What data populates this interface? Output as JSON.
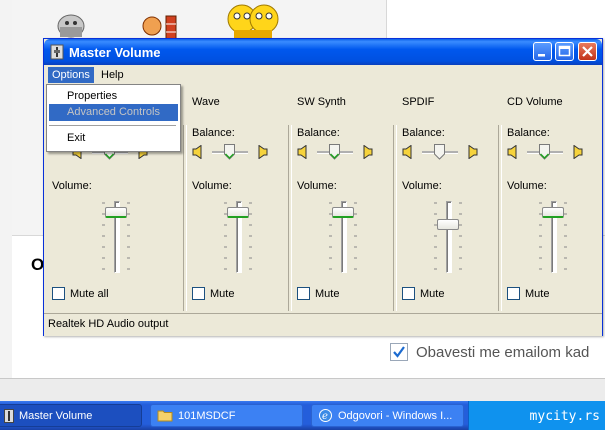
{
  "window": {
    "title": "Master Volume",
    "menu": [
      "Options",
      "Help"
    ],
    "status": "Realtek HD Audio output"
  },
  "options_menu": {
    "items": [
      "Properties",
      "Advanced Controls",
      "Exit"
    ]
  },
  "mixer": {
    "balance_label": "Balance:",
    "volume_label": "Volume:",
    "channels": [
      {
        "name": "",
        "mute_label": "Mute all",
        "volume": 0.9,
        "balance": 0.5
      },
      {
        "name": "Wave",
        "mute_label": "Mute",
        "volume": 0.9,
        "balance": 0.5
      },
      {
        "name": "SW Synth",
        "mute_label": "Mute",
        "volume": 0.9,
        "balance": 0.5
      },
      {
        "name": "SPDIF",
        "mute_label": "Mute",
        "volume": 0.7,
        "balance": 0.5
      },
      {
        "name": "CD Volume",
        "mute_label": "Mute",
        "volume": 0.9,
        "balance": 0.5
      }
    ]
  },
  "background": {
    "partial_letter": "O",
    "notify_label": "Obavesti me emailom kad",
    "notify_checked": true
  },
  "taskbar": {
    "items": [
      "Master Volume",
      "101MSDCF",
      "Odgovori - Windows I..."
    ],
    "tray_text": "mycity.rs"
  },
  "colors": {
    "titlebar": "#0058ee",
    "menu_highlight": "#316ac5",
    "taskbar": "#245edb"
  }
}
